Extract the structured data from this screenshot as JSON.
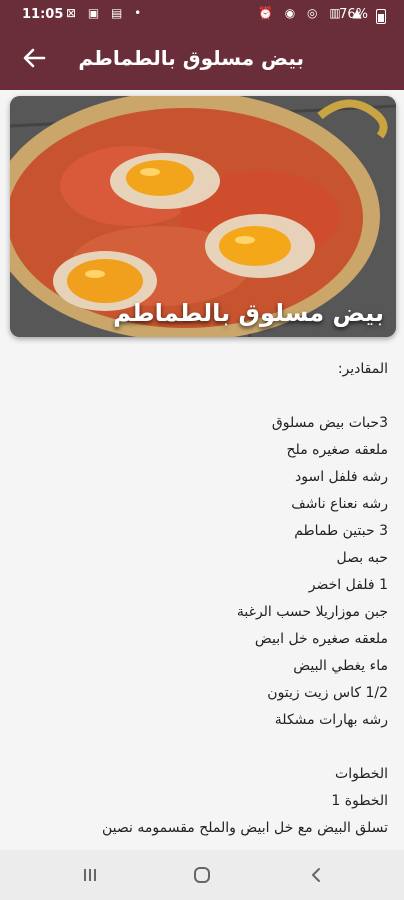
{
  "status_bar": {
    "time": "11:05",
    "battery": "76%"
  },
  "app_bar": {
    "title": "بيض مسلوق بالطماطم"
  },
  "hero": {
    "caption": "بيض مسلوق بالطماطم"
  },
  "content": {
    "ingredients_heading": "المقادير:",
    "ingredients": [
      "3حبات بيض مسلوق",
      "ملعقه صغيره ملح",
      "رشه فلفل اسود",
      "رشه نعناع ناشف",
      "3 حبتين طماطم",
      "حبه بصل",
      "1 فلفل اخضر",
      "جبن موزاريلا حسب الرغبة",
      "ملعقه صغيره خل ابيض",
      "ماء يغطي البيض",
      "1/2 كاس زيت زيتون",
      "رشه بهارات مشكلة"
    ],
    "steps_heading": "الخطوات",
    "step1_label": "الخطوة 1",
    "step1_text": "تسلق البيض مع خل ابيض والملح مقسمومه نصين"
  }
}
